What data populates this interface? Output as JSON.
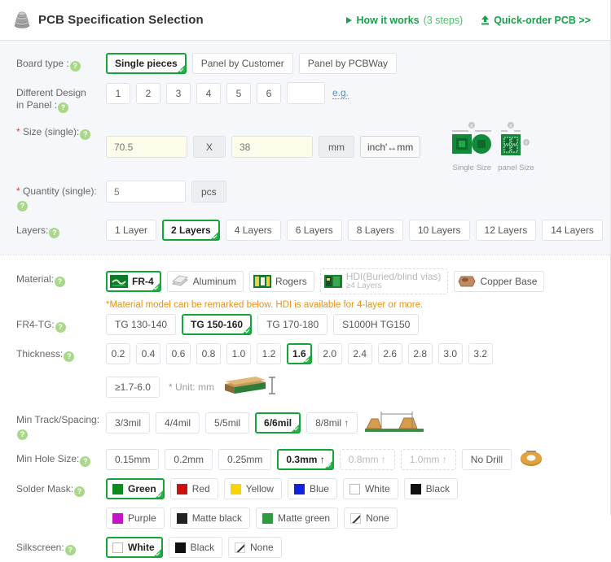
{
  "header": {
    "logo_icon": "pcb-stack-icon",
    "title": "PCB Specification Selection",
    "how_it_works": "How it works",
    "how_it_works_sub": "(3 steps)",
    "quick_order": "Quick-order PCB >>",
    "accent_color": "#18a04a"
  },
  "rows": {
    "board_type": {
      "label": "Board type :",
      "options": [
        "Single pieces",
        "Panel by Customer",
        "Panel by PCBWay"
      ],
      "selected": "Single pieces"
    },
    "different_design": {
      "label_line1": "Different Design",
      "label_line2": "in Panel :",
      "options": [
        "1",
        "2",
        "3",
        "4",
        "5",
        "6"
      ],
      "custom_value": "",
      "eg_link": "e.g."
    },
    "size": {
      "label": "Size (single):",
      "width_value": "70.5",
      "separator": "X",
      "height_value": "38",
      "unit": "mm",
      "convert_label": "inch'↔mm",
      "fig_single_caption": "Single Size",
      "fig_panel_caption": "panel Size"
    },
    "quantity": {
      "label": "Quantity (single):",
      "value": "5",
      "unit": "pcs"
    },
    "layers": {
      "label": "Layers:",
      "options": [
        "1 Layer",
        "2 Layers",
        "4 Layers",
        "6 Layers",
        "8 Layers",
        "10 Layers",
        "12 Layers",
        "14 Layers"
      ],
      "selected": "2 Layers"
    },
    "material": {
      "label": "Material:",
      "options": [
        {
          "name": "FR-4",
          "icon": "fr4-icon",
          "selected": true,
          "disabled": false
        },
        {
          "name": "Aluminum",
          "icon": "aluminum-icon",
          "selected": false,
          "disabled": false
        },
        {
          "name": "Rogers",
          "icon": "rogers-icon",
          "selected": false,
          "disabled": false
        },
        {
          "name": "HDI(Buried/blind vias)",
          "sub": "≥4 Layers",
          "icon": "hdi-icon",
          "selected": false,
          "disabled": true
        },
        {
          "name": "Copper Base",
          "icon": "copper-icon",
          "selected": false,
          "disabled": false
        }
      ],
      "note": "*Material model can be remarked below. HDI is available for 4-layer or more."
    },
    "fr4_tg": {
      "label": "FR4-TG:",
      "options": [
        "TG 130-140",
        "TG 150-160",
        "TG 170-180",
        "S1000H TG150"
      ],
      "selected": "TG 150-160"
    },
    "thickness": {
      "label": "Thickness:",
      "options": [
        "0.2",
        "0.4",
        "0.6",
        "0.8",
        "1.0",
        "1.2",
        "1.6",
        "2.0",
        "2.4",
        "2.6",
        "2.8",
        "3.0",
        "3.2"
      ],
      "selected": "1.6",
      "extra_option": "≥1.7-6.0",
      "unit_note": "* Unit: mm"
    },
    "min_track": {
      "label": "Min Track/Spacing:",
      "options": [
        {
          "name": "3/3mil",
          "selected": false,
          "disabled": false
        },
        {
          "name": "4/4mil",
          "selected": false,
          "disabled": false
        },
        {
          "name": "5/5mil",
          "selected": false,
          "disabled": false
        },
        {
          "name": "6/6mil",
          "selected": true,
          "disabled": false
        },
        {
          "name": "8/8mil ↑",
          "selected": false,
          "disabled": false
        }
      ]
    },
    "min_hole": {
      "label": "Min Hole Size:",
      "options": [
        {
          "name": "0.15mm",
          "selected": false,
          "disabled": false
        },
        {
          "name": "0.2mm",
          "selected": false,
          "disabled": false
        },
        {
          "name": "0.25mm",
          "selected": false,
          "disabled": false
        },
        {
          "name": "0.3mm ↑",
          "selected": true,
          "disabled": false
        },
        {
          "name": "0.8mm ↑",
          "selected": false,
          "disabled": true
        },
        {
          "name": "1.0mm ↑",
          "selected": false,
          "disabled": true
        },
        {
          "name": "No Drill",
          "selected": false,
          "disabled": false
        }
      ]
    },
    "solder_mask": {
      "label": "Solder Mask:",
      "options": [
        {
          "name": "Green",
          "color": "#0b8a1e",
          "selected": true
        },
        {
          "name": "Red",
          "color": "#cc1111",
          "selected": false
        },
        {
          "name": "Yellow",
          "color": "#fbd304",
          "selected": false
        },
        {
          "name": "Blue",
          "color": "#1122dd",
          "selected": false
        },
        {
          "name": "White",
          "color": "#ffffff",
          "selected": false
        },
        {
          "name": "Black",
          "color": "#111111",
          "selected": false
        },
        {
          "name": "Purple",
          "color": "#c315c3",
          "selected": false
        },
        {
          "name": "Matte black",
          "color": "#222222",
          "selected": false
        },
        {
          "name": "Matte green",
          "color": "#2f9b3f",
          "selected": false
        },
        {
          "name": "None",
          "color": "none",
          "selected": false
        }
      ]
    },
    "silkscreen": {
      "label": "Silkscreen:",
      "options": [
        {
          "name": "White",
          "color": "#ffffff",
          "selected": true
        },
        {
          "name": "Black",
          "color": "#111111",
          "selected": false
        },
        {
          "name": "None",
          "color": "none",
          "selected": false
        }
      ]
    }
  }
}
